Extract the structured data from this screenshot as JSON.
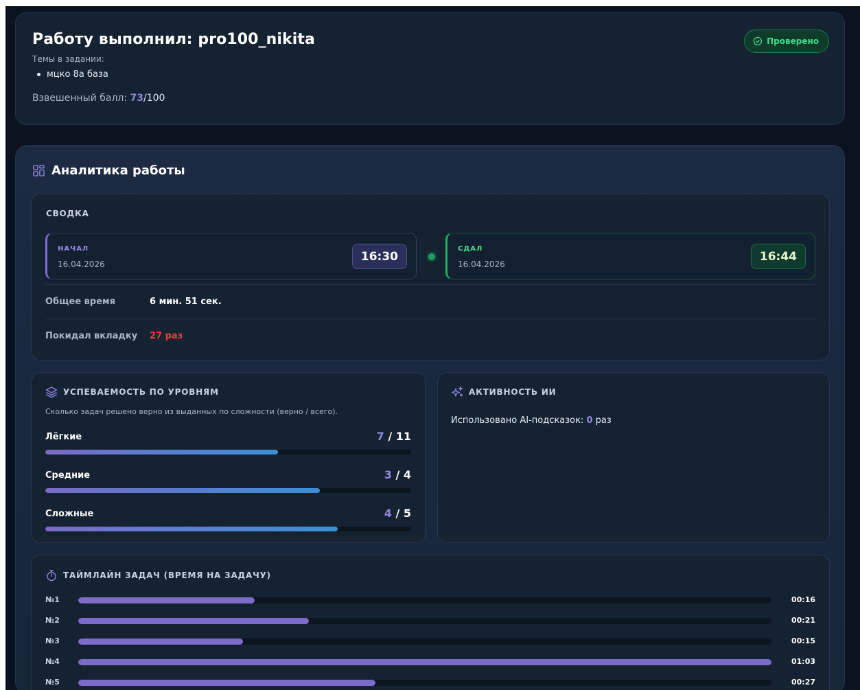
{
  "header": {
    "title": "Работу выполнил: pro100_nikita",
    "topics_label": "Темы в задании:",
    "topics": [
      "мцко 8а база"
    ],
    "score_label": "Взвешенный балл: ",
    "score": "73",
    "score_max": "/100",
    "status": "Проверено"
  },
  "analytics": {
    "title": "Аналитика работы",
    "summary": {
      "heading": "СВОДКА",
      "start": {
        "label": "НАЧАЛ",
        "date": "16.04.2026",
        "time": "16:30"
      },
      "end": {
        "label": "СДАЛ",
        "date": "16.04.2026",
        "time": "16:44"
      },
      "total_time_label": "Общее время",
      "total_time": "6 мин. 51 сек.",
      "left_tab_label": "Покидал вкладку",
      "left_tab": "27 раз"
    },
    "levels": {
      "heading": "УСПЕВАЕМОСТЬ ПО УРОВНЯМ",
      "description": "Сколько задач решено верно из выданных по сложности (верно / всего).",
      "items": [
        {
          "name": "Лёгкие",
          "correct": "7",
          "total": "11",
          "fraction": 0.636
        },
        {
          "name": "Средние",
          "correct": "3",
          "total": "4",
          "fraction": 0.75
        },
        {
          "name": "Сложные",
          "correct": "4",
          "total": "5",
          "fraction": 0.8
        }
      ]
    },
    "ai": {
      "heading": "АКТИВНОСТЬ ИИ",
      "text_before": "Использовано AI-подсказок: ",
      "count": "0",
      "text_after": " раз"
    },
    "timeline": {
      "heading": "ТАЙМЛАЙН ЗАДАЧ (ВРЕМЯ НА ЗАДАЧУ)",
      "items": [
        {
          "no": "№1",
          "time": "00:16",
          "fraction": 0.254
        },
        {
          "no": "№2",
          "time": "00:21",
          "fraction": 0.333
        },
        {
          "no": "№3",
          "time": "00:15",
          "fraction": 0.238
        },
        {
          "no": "№4",
          "time": "01:03",
          "fraction": 1.0
        },
        {
          "no": "№5",
          "time": "00:27",
          "fraction": 0.429
        }
      ]
    }
  },
  "colors": {
    "accent": "#8f86e0",
    "success": "#3ddc8a",
    "danger": "#ef3b3b",
    "background": "#0b1220"
  }
}
